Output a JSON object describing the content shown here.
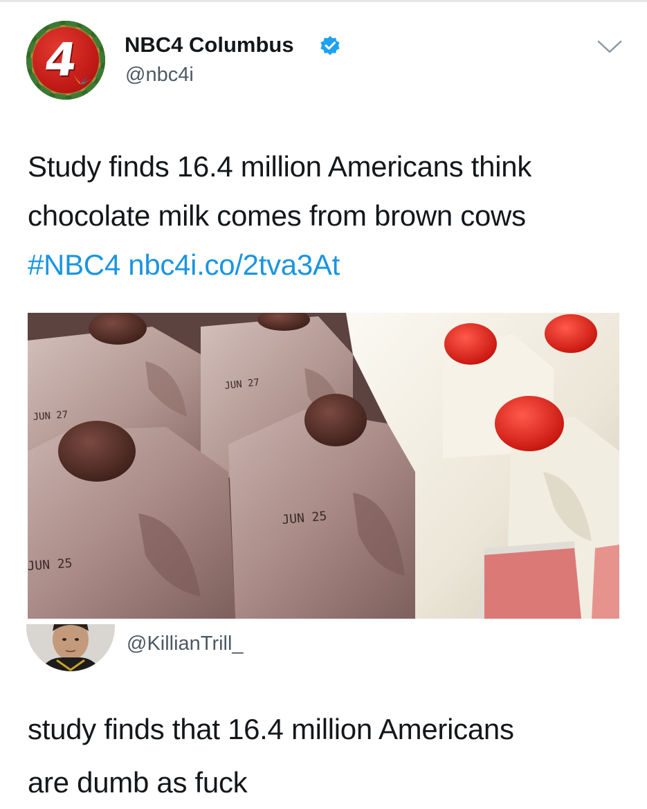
{
  "tweet": {
    "author": {
      "display_name": "NBC4 Columbus",
      "handle": "@nbc4i",
      "verified": true,
      "avatar_icon": "nbc4-logo-icon",
      "avatar_text": "4"
    },
    "text_lines": [
      "Study finds 16.4 million Americans think",
      "chocolate milk comes from brown cows"
    ],
    "hashtag": "#NBC4",
    "link": "nbc4i.co/2tva3At",
    "photo": {
      "date_labels": [
        "JUN 27",
        "JUN 27",
        "JUN 25",
        "JUN 25"
      ]
    }
  },
  "reply": {
    "handle": "@KillianTrill_",
    "text_lines": [
      "study finds that 16.4 million Americans",
      "are dumb as fuck"
    ]
  },
  "colors": {
    "link": "#1b95e0",
    "verified": "#1da1f2",
    "text": "#14171a",
    "muted": "#4d5963"
  }
}
